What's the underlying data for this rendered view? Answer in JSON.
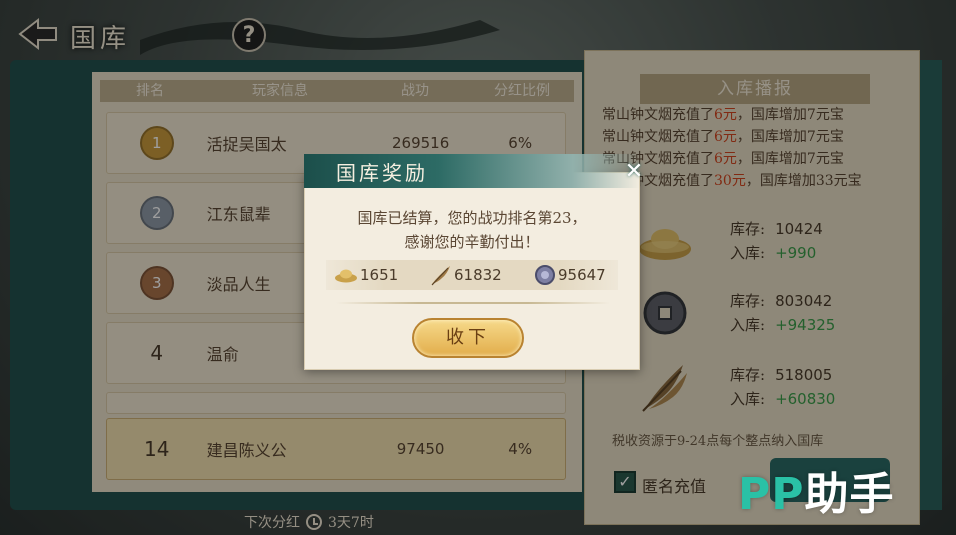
{
  "topbar": {
    "title": "国库"
  },
  "ranking": {
    "headers": [
      "排名",
      "玩家信息",
      "战功",
      "分红比例"
    ],
    "rows": [
      {
        "rank": "1",
        "name": "活捉吴国太",
        "score": "269516",
        "ratio": "6%"
      },
      {
        "rank": "2",
        "name": "江东鼠辈",
        "score": "",
        "ratio": ""
      },
      {
        "rank": "3",
        "name": "淡品人生",
        "score": "",
        "ratio": ""
      },
      {
        "rank": "4",
        "name": "温俞",
        "score": "",
        "ratio": ""
      }
    ],
    "my_row": {
      "rank": "14",
      "name": "建昌陈义公",
      "score": "97450",
      "ratio": "4%"
    }
  },
  "footer": {
    "label": "下次分红",
    "time": "3天7时"
  },
  "right_panel": {
    "title": "入库播报",
    "log": [
      {
        "pre": "常山钟文烟充值了",
        "amt": "6元",
        "post": "，国库增加7元宝"
      },
      {
        "pre": "常山钟文烟充值了",
        "amt": "6元",
        "post": "，国库增加7元宝"
      },
      {
        "pre": "常山钟文烟充值了",
        "amt": "6元",
        "post": "，国库增加7元宝"
      },
      {
        "pre": "常山钟文烟充值了",
        "amt": "30元",
        "post": "，国库增加33元宝"
      }
    ],
    "resources": [
      {
        "icon": "gold-ingot-icon",
        "stock_label": "库存:",
        "stock": "10424",
        "in_label": "入库:",
        "in": "+990"
      },
      {
        "icon": "copper-coin-icon",
        "stock_label": "库存:",
        "stock": "803042",
        "in_label": "入库:",
        "in": "+94325"
      },
      {
        "icon": "feather-icon",
        "stock_label": "库存:",
        "stock": "518005",
        "in_label": "入库:",
        "in": "+60830"
      }
    ],
    "note": "税收资源于9-24点每个整点纳入国库",
    "anon_label": "匿名充值"
  },
  "modal": {
    "title": "国库奖励",
    "message_line1": "国库已结算，您的战功排名第23，",
    "message_line2": "感谢您的辛勤付出！",
    "rewards": [
      {
        "icon": "gold-ingot-icon",
        "value": "1651"
      },
      {
        "icon": "feather-icon",
        "value": "61832"
      },
      {
        "icon": "coin-icon",
        "value": "95647"
      }
    ],
    "collect_label": "收下"
  },
  "watermark": {
    "pp": "PP",
    "text": "助手"
  },
  "colors": {
    "teal": "#23514e",
    "parchment": "#e9dfc8",
    "gold_button": "#e2ad4b",
    "gain_green": "#3a9c4a",
    "amount_red": "#d0451f"
  }
}
